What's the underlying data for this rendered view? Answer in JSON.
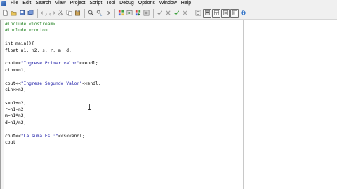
{
  "menu": {
    "items": [
      "File",
      "Edit",
      "Search",
      "View",
      "Project",
      "Script",
      "Tool",
      "Debug",
      "Options",
      "Window",
      "Help"
    ]
  },
  "toolbar": {
    "icons": [
      "new-file-icon",
      "open-folder-icon",
      "save-icon",
      "save-all-icon",
      "undo-icon",
      "redo-icon",
      "cut-icon",
      "copy-icon",
      "paste-icon",
      "find-icon",
      "replace-icon",
      "goto-icon",
      "compile-icon",
      "run-icon",
      "compile-run-icon",
      "rebuild-icon",
      "check-icon",
      "stop-icon",
      "debug-icon",
      "step-icon",
      "class-browser-icon",
      "new-project-icon",
      "window-layout-icon",
      "dialog-icon",
      "toggle-panel-icon",
      "about-icon"
    ]
  },
  "colors": {
    "preprocessor": "#2f8a2f",
    "string": "#1a1aa6",
    "menubar_bg": "#f0f0f0"
  },
  "editor": {
    "lines": [
      "#include <iostream>",
      "#include <conio>",
      "",
      "int main(){",
      "float n1, n2, s, r, m, d;",
      "",
      "cout<<\"Ingrese Primer valor\"<<endl;",
      "cin>>n1;",
      "",
      "cout<<\"Ingrese Segundo Valor\"<<endl;",
      "cin>>n2;",
      "",
      "s=n1+n2;",
      "r=n1-n2;",
      "m=n1*n2;",
      "d=n1/n2;",
      "",
      "cout<<\"La suma Es :\"<<s<<endl;",
      "cout"
    ]
  }
}
